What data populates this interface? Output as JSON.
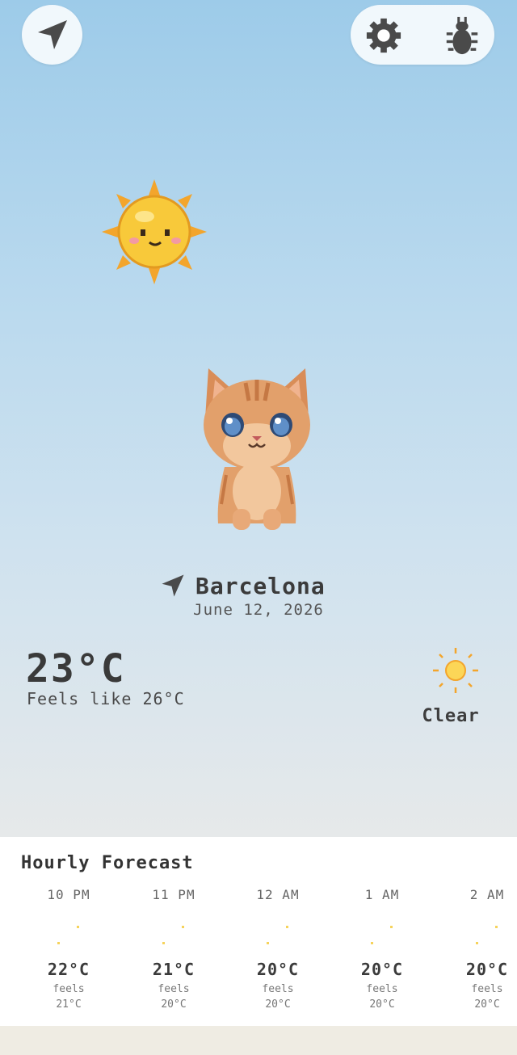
{
  "location": {
    "city": "Barcelona",
    "date": "June 12, 2026"
  },
  "current": {
    "temperature": "23°C",
    "feels_like": "Feels like 26°C",
    "condition": "Clear",
    "condition_icon": "sun-icon"
  },
  "toolbar": {
    "location_icon": "location-arrow-icon",
    "settings_icon": "gear-icon",
    "debug_icon": "bug-icon"
  },
  "hourly": {
    "title": "Hourly Forecast",
    "items": [
      {
        "time": "10 PM",
        "icon": "moon-icon",
        "temp": "22°C",
        "feels_label": "feels",
        "feels": "21°C"
      },
      {
        "time": "11 PM",
        "icon": "moon-icon",
        "temp": "21°C",
        "feels_label": "feels",
        "feels": "20°C"
      },
      {
        "time": "12 AM",
        "icon": "moon-icon",
        "temp": "20°C",
        "feels_label": "feels",
        "feels": "20°C"
      },
      {
        "time": "1 AM",
        "icon": "moon-icon",
        "temp": "20°C",
        "feels_label": "feels",
        "feels": "20°C"
      },
      {
        "time": "2 AM",
        "icon": "moon-icon",
        "temp": "20°C",
        "feels_label": "feels",
        "feels": "20°C"
      }
    ]
  },
  "colors": {
    "sky_top": "#9dcbe9",
    "sky_bottom": "#e6e9ea",
    "text": "#3b3b3b",
    "sun": "#f6c43a",
    "moon": "#b38ad6"
  }
}
